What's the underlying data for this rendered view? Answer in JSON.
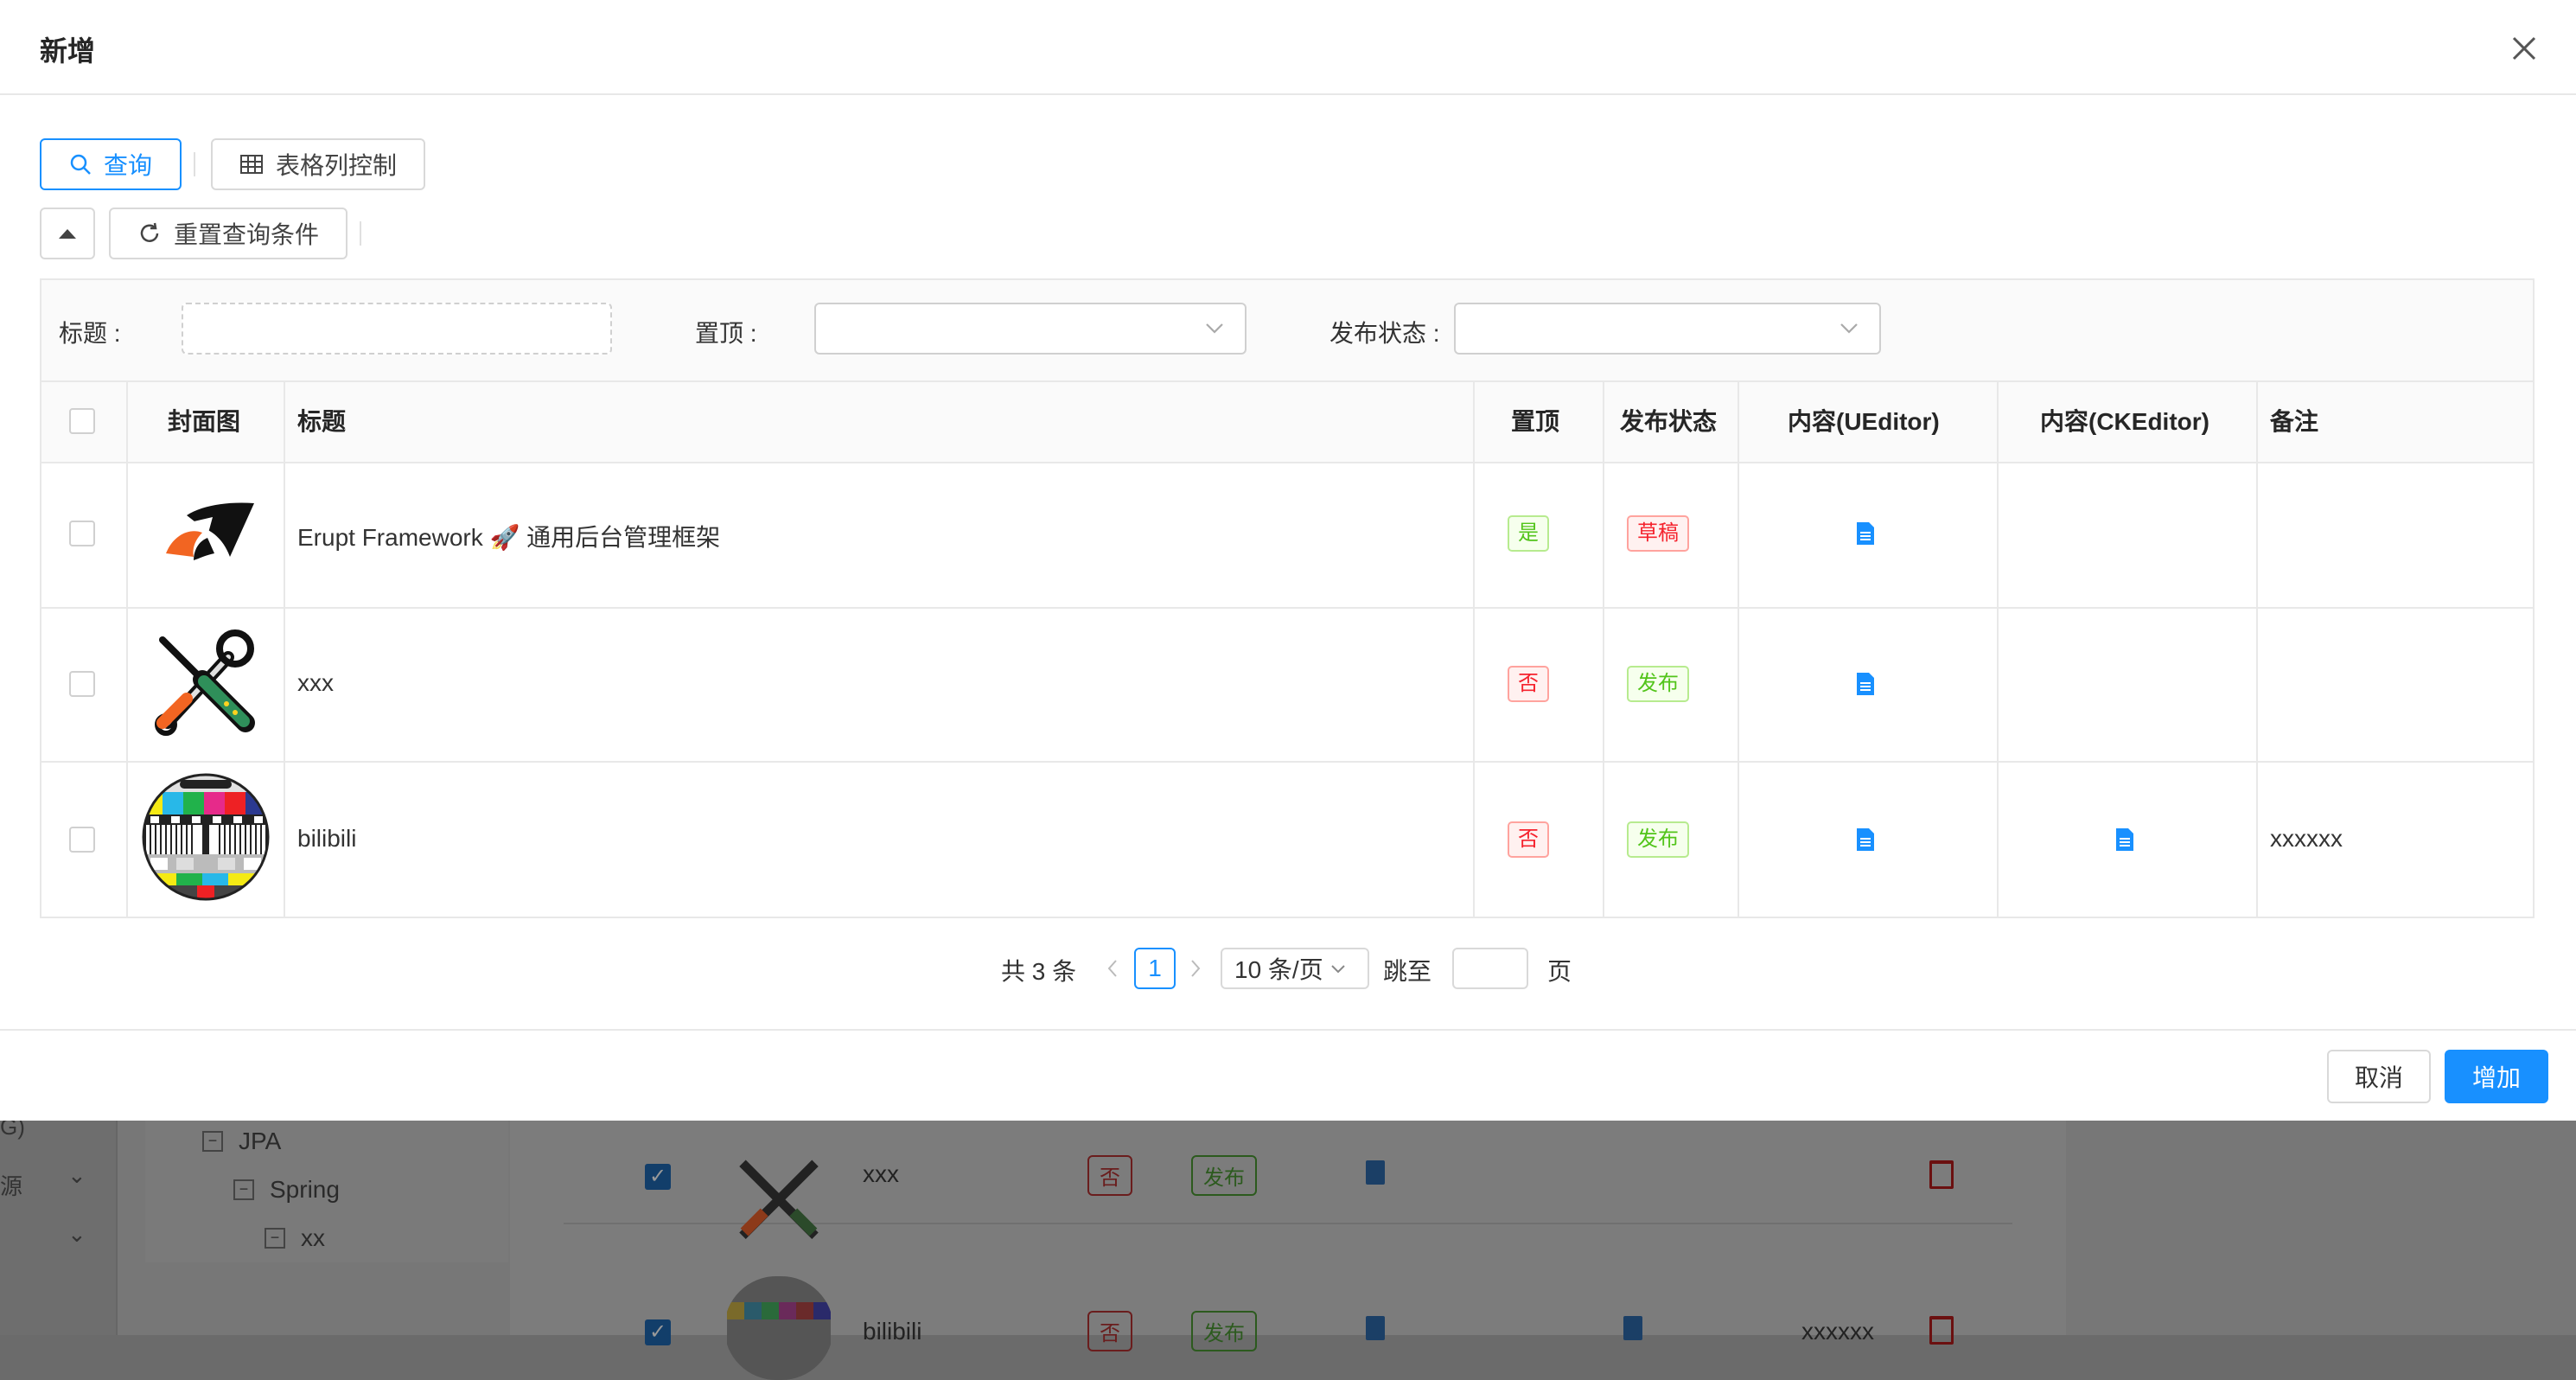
{
  "modal": {
    "title": "新增",
    "query_button": "查询",
    "column_control_button": "表格列控制",
    "reset_button": "重置查询条件",
    "cancel_button": "取消",
    "submit_button": "增加"
  },
  "search": {
    "title_label": "标题 :",
    "top_label": "置顶 :",
    "status_label": "发布状态 :"
  },
  "table": {
    "headers": [
      "封面图",
      "标题",
      "置顶",
      "发布状态",
      "内容(UEditor)",
      "内容(CKEditor)",
      "备注"
    ],
    "rows": [
      {
        "title": "Erupt Framework 🚀 通用后台管理框架",
        "top": "是",
        "status": "草稿",
        "ueditor": "doc-icon",
        "ckeditor": "",
        "remark": ""
      },
      {
        "title": "xxx",
        "top": "否",
        "status": "发布",
        "ueditor": "doc-icon",
        "ckeditor": "",
        "remark": ""
      },
      {
        "title": "bilibili",
        "top": "否",
        "status": "发布",
        "ueditor": "doc-icon",
        "ckeditor": "doc-icon",
        "remark": "xxxxxx"
      }
    ]
  },
  "pagination": {
    "total": "共 3 条",
    "current_page": "1",
    "page_size": "10 条/页",
    "jump_label": "跳至",
    "page_suffix": "页"
  },
  "background": {
    "sidebar": [
      "G)",
      "源"
    ],
    "tree": [
      "JPA",
      "Spring",
      "xx"
    ],
    "rows": [
      {
        "title": "xxx",
        "top": "否",
        "status": "发布",
        "remark": ""
      },
      {
        "title": "bilibili",
        "top": "否",
        "status": "发布",
        "remark": "xxxxxx"
      }
    ]
  },
  "colors": {
    "primary": "#1890ff",
    "tag_green": "#52c41a",
    "tag_red": "#f5222d",
    "overlay": "#6b6b6b"
  }
}
